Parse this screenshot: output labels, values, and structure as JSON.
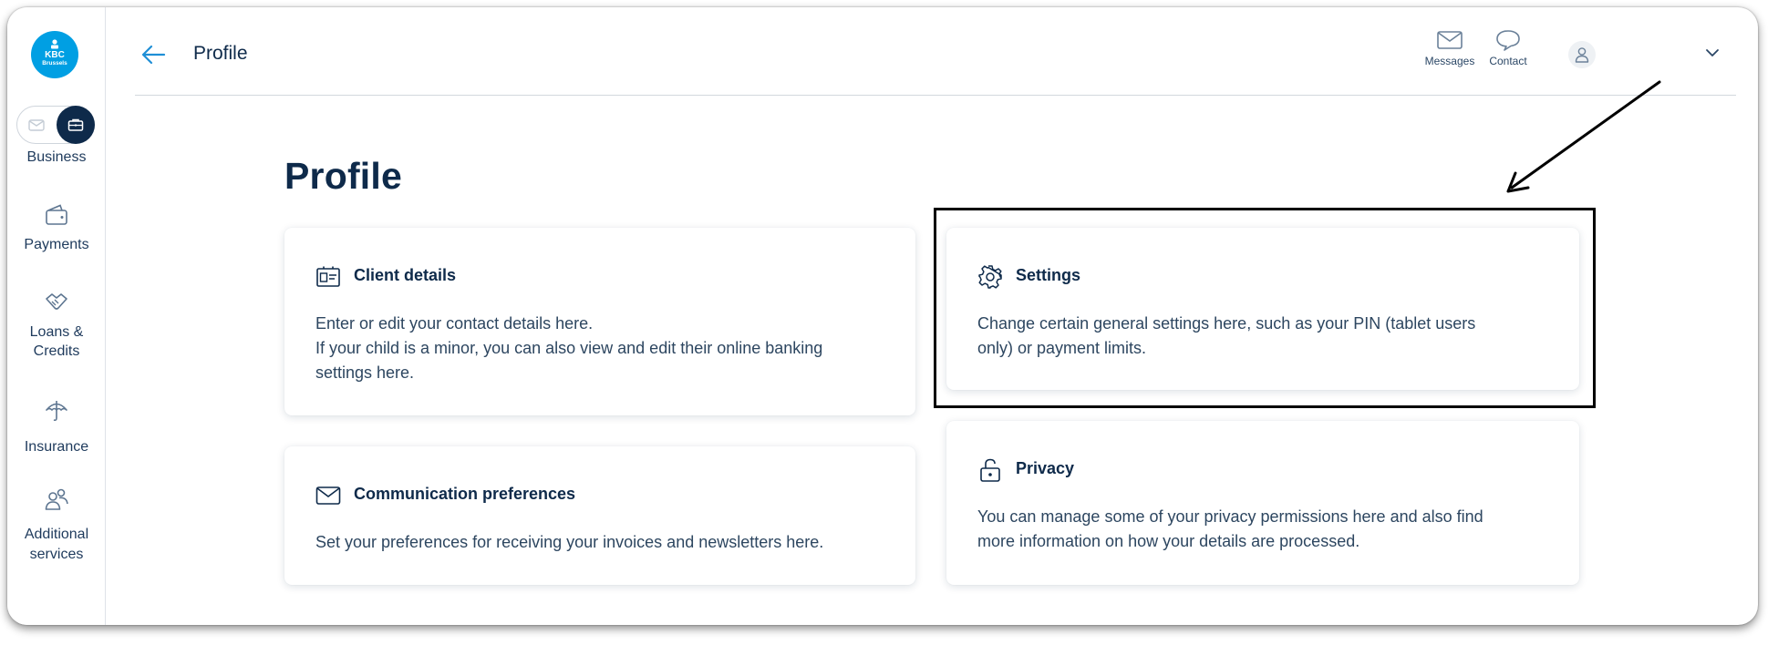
{
  "sidebar": {
    "logo": {
      "brand": "KBC",
      "city": "Brussels"
    },
    "toggle": {
      "active": "business",
      "label": "Business"
    },
    "items": [
      {
        "label_lines": [
          "Payments"
        ],
        "icon": "wallet-icon"
      },
      {
        "label_lines": [
          "Loans &",
          "Credits"
        ],
        "icon": "handshake-icon"
      },
      {
        "label_lines": [
          "Insurance"
        ],
        "icon": "umbrella-icon"
      },
      {
        "label_lines": [
          "Additional",
          "services"
        ],
        "icon": "people-icon"
      }
    ]
  },
  "header": {
    "title": "Profile",
    "messages_label": "Messages",
    "contact_label": "Contact"
  },
  "main": {
    "title": "Profile",
    "cards": [
      {
        "title": "Client details",
        "icon": "id-card-icon",
        "lines": [
          "Enter or edit your contact details here.",
          "If your child is a minor, you can also view and edit their online banking",
          "settings here."
        ]
      },
      {
        "title": "Settings",
        "icon": "gear-icon",
        "lines": [
          "Change certain general settings here, such as your PIN (tablet users",
          "only) or payment limits."
        ]
      },
      {
        "title": "Communication preferences",
        "icon": "envelope-icon",
        "lines": [
          "Set your preferences for receiving your invoices and newsletters here."
        ]
      },
      {
        "title": "Privacy",
        "icon": "padlock-icon",
        "lines": [
          "You can manage some of your privacy permissions here and also find",
          "more information on how your details are processed."
        ]
      }
    ]
  },
  "colors": {
    "navy": "#0e2a4a",
    "brand_blue": "#009fe3",
    "annotation": "#000000"
  }
}
